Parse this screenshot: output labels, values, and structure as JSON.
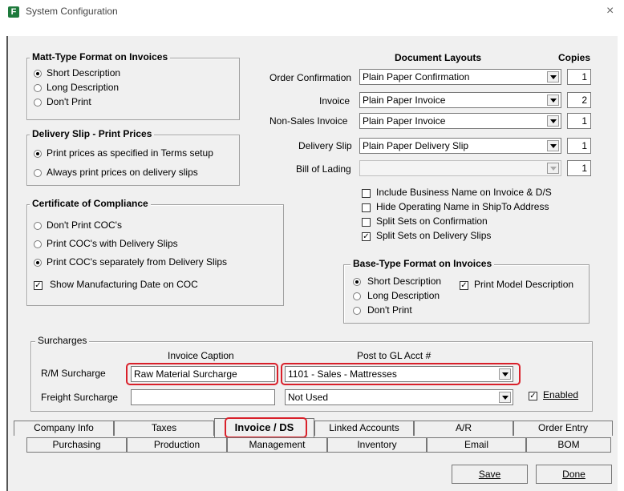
{
  "window": {
    "title": "System Configuration",
    "app_icon_letter": "F",
    "close_glyph": "×"
  },
  "matt_type": {
    "title": "Matt-Type Format on Invoices",
    "options": [
      "Short Description",
      "Long Description",
      "Don't Print"
    ],
    "selected": "Short Description"
  },
  "delivery_slip": {
    "title": "Delivery Slip - Print Prices",
    "options": [
      "Print prices as specified in Terms setup",
      "Always print prices on delivery slips"
    ],
    "selected": "Print prices as specified in Terms setup"
  },
  "coc": {
    "title": "Certificate of Compliance",
    "options": [
      "Don't Print COC's",
      "Print COC's with Delivery Slips",
      "Print COC's separately from Delivery Slips"
    ],
    "selected": "Print COC's separately from Delivery Slips",
    "show_mfg_date_label": "Show Manufacturing Date on COC",
    "show_mfg_date_checked": true
  },
  "document_layouts": {
    "header": "Document Layouts",
    "copies_header": "Copies",
    "rows": [
      {
        "label": "Order Confirmation",
        "layout": "Plain Paper Confirmation",
        "copies": "1",
        "enabled": true
      },
      {
        "label": "Invoice",
        "layout": "Plain Paper Invoice",
        "copies": "2",
        "enabled": true
      },
      {
        "label": "Non-Sales Invoice",
        "layout": "Plain Paper Invoice",
        "copies": "1",
        "enabled": true
      },
      {
        "label": "Delivery Slip",
        "layout": "Plain Paper Delivery Slip",
        "copies": "1",
        "enabled": true
      },
      {
        "label": "Bill of Lading",
        "layout": "",
        "copies": "1",
        "enabled": false
      }
    ]
  },
  "options": [
    {
      "label": "Include Business Name on Invoice & D/S",
      "checked": false
    },
    {
      "label": "Hide Operating Name in ShipTo Address",
      "checked": false
    },
    {
      "label": "Split Sets on Confirmation",
      "checked": false
    },
    {
      "label": "Split Sets on Delivery Slips",
      "checked": true
    }
  ],
  "base_type": {
    "title": "Base-Type Format on Invoices",
    "options": [
      "Short Description",
      "Long Description",
      "Don't Print"
    ],
    "selected": "Short Description",
    "print_model_label": "Print Model Description",
    "print_model_checked": true
  },
  "surcharges": {
    "title": "Surcharges",
    "caption_header": "Invoice Caption",
    "gl_header": "Post to GL Acct #",
    "rm": {
      "label": "R/M Surcharge",
      "caption": "Raw Material Surcharge",
      "gl": "1101 - Sales -  Mattresses"
    },
    "freight": {
      "label": "Freight Surcharge",
      "caption": "",
      "gl": "Not Used"
    },
    "enabled_label": "Enabled",
    "enabled_checked": true
  },
  "tabs": {
    "row1": [
      "Company Info",
      "Taxes",
      "Invoice / DS",
      "Linked Accounts",
      "A/R",
      "Order Entry"
    ],
    "row2": [
      "Purchasing",
      "Production",
      "Management",
      "Inventory",
      "Email",
      "BOM"
    ],
    "active": "Invoice / DS"
  },
  "buttons": {
    "save": "Save",
    "done": "Done"
  },
  "glyphs": {
    "check": "✓"
  }
}
